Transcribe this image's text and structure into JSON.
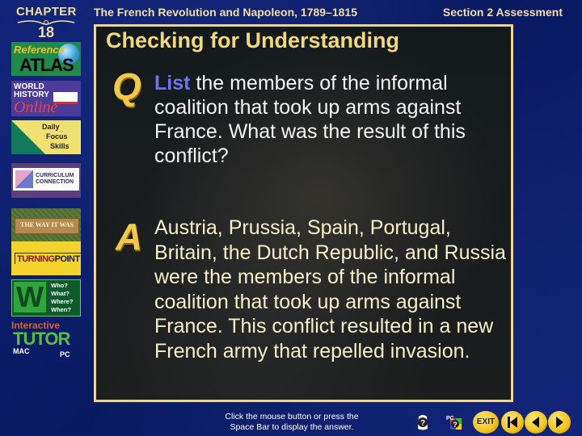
{
  "header": {
    "chapter_label": "CHAPTER",
    "chapter_number": "18",
    "book_title": "The French Revolution and Napoleon, 1789–1815",
    "section_title": "Section 2 Assessment"
  },
  "sidebar": {
    "reference_atlas": {
      "line1": "Reference",
      "line2": "ATLAS"
    },
    "world_history_online": {
      "line1": "WORLD",
      "line2": "HISTORY",
      "line3": "Online"
    },
    "daily_focus_skills": {
      "line1": "Daily",
      "line2": "Focus",
      "line3": "Skills"
    },
    "curriculum_connection": {
      "line1": "CURRICULUM",
      "line2": "CONNECTION"
    },
    "the_way_it_was": {
      "label": "THE WAY IT WAS"
    },
    "turning_point": {
      "part1": "TURNING",
      "part2": "POINT"
    },
    "five_w": {
      "letter": "W",
      "line1": "Who?",
      "line2": "What?",
      "line3": "Where?",
      "line4": "When?"
    },
    "interactive_tutor": {
      "line1": "Interactive",
      "line2": "TUTOR",
      "mac": "MAC",
      "pc": "PC"
    }
  },
  "panel": {
    "title": "Checking for Understanding",
    "q_label": "Q",
    "a_label": "A",
    "question_keyword": "List",
    "question_rest": " the members of the informal coalition that took up arms against France. What was the result of this conflict?",
    "answer": "Austria, Prussia, Spain, Portugal, Britain, the Dutch Republic, and Russia were the members of the informal coalition that took up arms against France. This conflict resulted in a new French army that repelled invasion."
  },
  "footer": {
    "instruction_line1": "Click the mouse button or press the",
    "instruction_line2": "Space Bar to display the answer.",
    "exit_label": "EXIT",
    "icons": [
      "mac-help-icon",
      "pc-help-icon",
      "exit-button",
      "first-slide-button",
      "previous-slide-button",
      "next-slide-button"
    ]
  },
  "colors": {
    "background_blue": "#0c1d6e",
    "header_text": "#f1dfa1",
    "panel_border": "#e8d59a",
    "title_gold": "#f1d97a",
    "keyword_blue": "#6f75f0",
    "answer_text": "#f7efc8",
    "nav_gold": "#f3c318"
  }
}
